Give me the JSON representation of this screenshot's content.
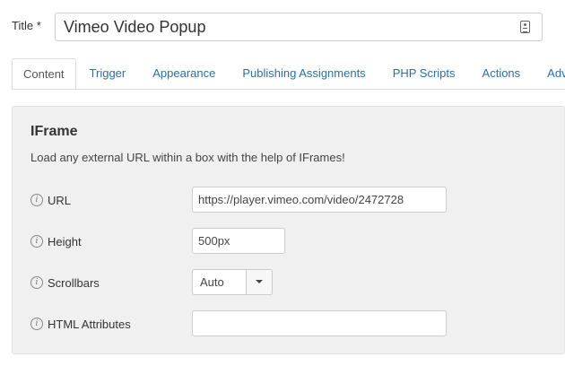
{
  "title_field": {
    "label": "Title *",
    "value": "Vimeo Video Popup",
    "icon": "contact-card-icon"
  },
  "tabs": [
    {
      "label": "Content",
      "active": true
    },
    {
      "label": "Trigger",
      "active": false
    },
    {
      "label": "Appearance",
      "active": false
    },
    {
      "label": "Publishing Assignments",
      "active": false
    },
    {
      "label": "PHP Scripts",
      "active": false
    },
    {
      "label": "Actions",
      "active": false
    },
    {
      "label": "Adva",
      "active": false
    }
  ],
  "panel": {
    "title": "IFrame",
    "description": "Load any external URL within a box with the help of IFrames!",
    "fields": {
      "url": {
        "label": "URL",
        "value": "https://player.vimeo.com/video/2472728"
      },
      "height": {
        "label": "Height",
        "value": "500px"
      },
      "scrollbars": {
        "label": "Scrollbars",
        "value": "Auto"
      },
      "html_attributes": {
        "label": "HTML Attributes",
        "value": ""
      }
    },
    "info_glyph": "i"
  },
  "colors": {
    "link": "#2a6fa8",
    "panel_bg": "#f0f0f0",
    "border": "#cccccc"
  }
}
